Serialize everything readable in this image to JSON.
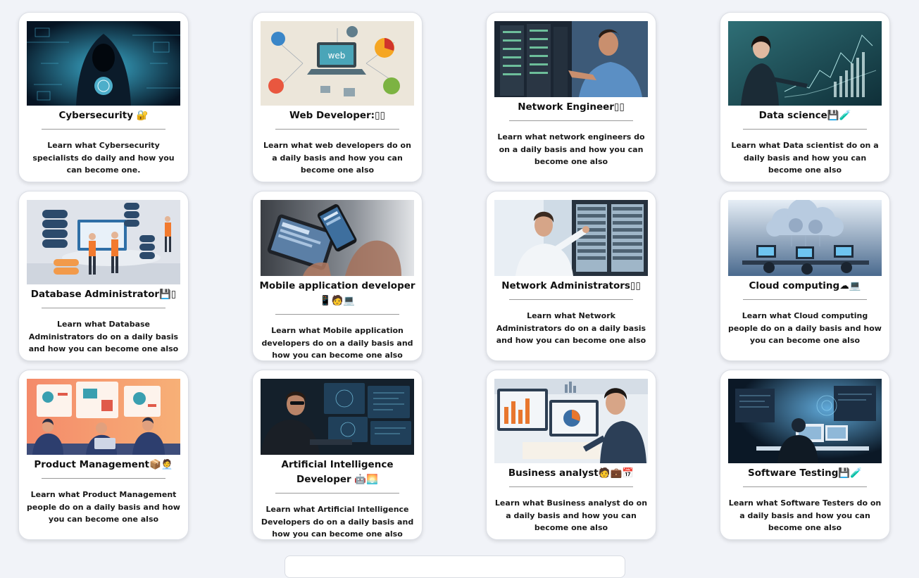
{
  "cards": [
    {
      "title": "Cybersecurity 🔐",
      "description": "Learn what Cybersecurity specialists do daily and how you can become one.",
      "image": "hooded-hacker-illustration"
    },
    {
      "title": "Web Developer:▯▯",
      "description": "Learn what web developers do on a daily basis and how you can become one also",
      "image": "web-laptop-illustration",
      "image_text": "web"
    },
    {
      "title": "Network Engineer▯▯",
      "description": "Learn what network engineers do on a daily basis and how you can become one also",
      "image": "engineer-at-server-rack-photo"
    },
    {
      "title": "Data science💾🧪",
      "description": "Learn what Data scientist do on a daily basis and how you can become one also",
      "image": "data-scientist-charts-illustration"
    },
    {
      "title": "Database Administrator💾▯",
      "description": "Learn what Database Administrators do on a daily basis and how you can become one also",
      "image": "database-stacks-illustration"
    },
    {
      "title": "Mobile application developer📱🧑💻",
      "description": "Learn what Mobile application developers do on a daily basis and how you can become one also",
      "image": "hands-phone-tablet-photo"
    },
    {
      "title": "Network Administrators▯▯",
      "description": "Learn what Network Administrators do on a daily basis and how you can become one also",
      "image": "admin-at-server-rack-photo"
    },
    {
      "title": "Cloud computing☁💻",
      "description": "Learn what Cloud computing people do on a daily basis and how you can become one also",
      "image": "cloud-workstations-illustration"
    },
    {
      "title": "Product Management📦🧑‍💼",
      "description": "Learn what Product Management people do on a daily basis and how you can become one also",
      "image": "team-meeting-illustration"
    },
    {
      "title": "Artificial Intelligence Developer 🤖🌅",
      "description": "Learn what Artificial Intelligence Developers do on a daily basis and how you can become one also",
      "image": "ai-developer-screens-photo"
    },
    {
      "title": "Business analyst🧑💼📅",
      "description": "Learn what Business analyst do on a daily basis and how you can become one also",
      "image": "analyst-charts-illustration"
    },
    {
      "title": "Software Testing💾🧪",
      "description": "Learn what Software Testers do on a daily basis and how you can become one also",
      "image": "tester-monitors-illustration"
    }
  ]
}
